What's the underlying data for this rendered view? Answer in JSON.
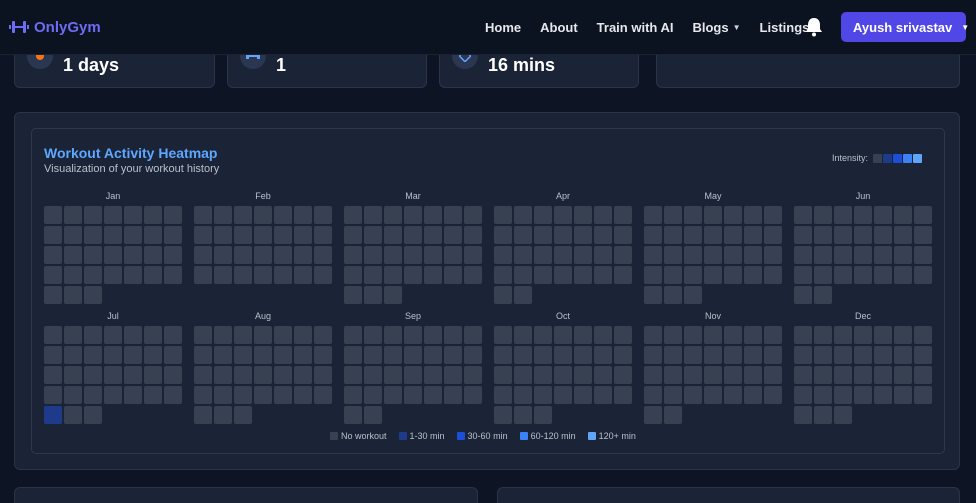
{
  "brand": {
    "name": "OnlyGym"
  },
  "nav": {
    "links": [
      {
        "label": "Home",
        "dropdown": false
      },
      {
        "label": "About",
        "dropdown": false
      },
      {
        "label": "Train with AI",
        "dropdown": false
      },
      {
        "label": "Blogs",
        "dropdown": true
      },
      {
        "label": "Listings",
        "dropdown": true
      }
    ],
    "user_label": "Ayush srivastav"
  },
  "stats": [
    {
      "value": "1 days",
      "icon": "flame-icon"
    },
    {
      "value": "1",
      "icon": "dumbbell-icon"
    },
    {
      "value": "16 mins",
      "icon": "timer-icon"
    },
    {
      "value": "",
      "icon": ""
    }
  ],
  "heatmap": {
    "title": "Workout Activity Heatmap",
    "subtitle": "Visualization of your workout history",
    "intensity_label": "Intensity:",
    "colors": [
      "#374152",
      "#1e3a8a",
      "#1d4ed8",
      "#3b82f6",
      "#60a5fa"
    ],
    "months": [
      {
        "name": "Jan",
        "days": 31,
        "lead": 0
      },
      {
        "name": "Feb",
        "days": 28,
        "lead": 0
      },
      {
        "name": "Mar",
        "days": 31,
        "lead": 0
      },
      {
        "name": "Apr",
        "days": 30,
        "lead": 0
      },
      {
        "name": "May",
        "days": 31,
        "lead": 0
      },
      {
        "name": "Jun",
        "days": 30,
        "lead": 0
      },
      {
        "name": "Jul",
        "days": 31,
        "lead": 0
      },
      {
        "name": "Aug",
        "days": 31,
        "lead": 0
      },
      {
        "name": "Sep",
        "days": 30,
        "lead": 0
      },
      {
        "name": "Oct",
        "days": 31,
        "lead": 0
      },
      {
        "name": "Nov",
        "days": 30,
        "lead": 0
      },
      {
        "name": "Dec",
        "days": 31,
        "lead": 0
      }
    ],
    "activity": [
      {
        "month": "Jul",
        "day": 29,
        "level": 1
      }
    ],
    "legend": [
      {
        "label": "No workout",
        "level": 0
      },
      {
        "label": "1-30 min",
        "level": 1
      },
      {
        "label": "30-60 min",
        "level": 2
      },
      {
        "label": "60-120 min",
        "level": 3
      },
      {
        "label": "120+ min",
        "level": 4
      }
    ]
  }
}
